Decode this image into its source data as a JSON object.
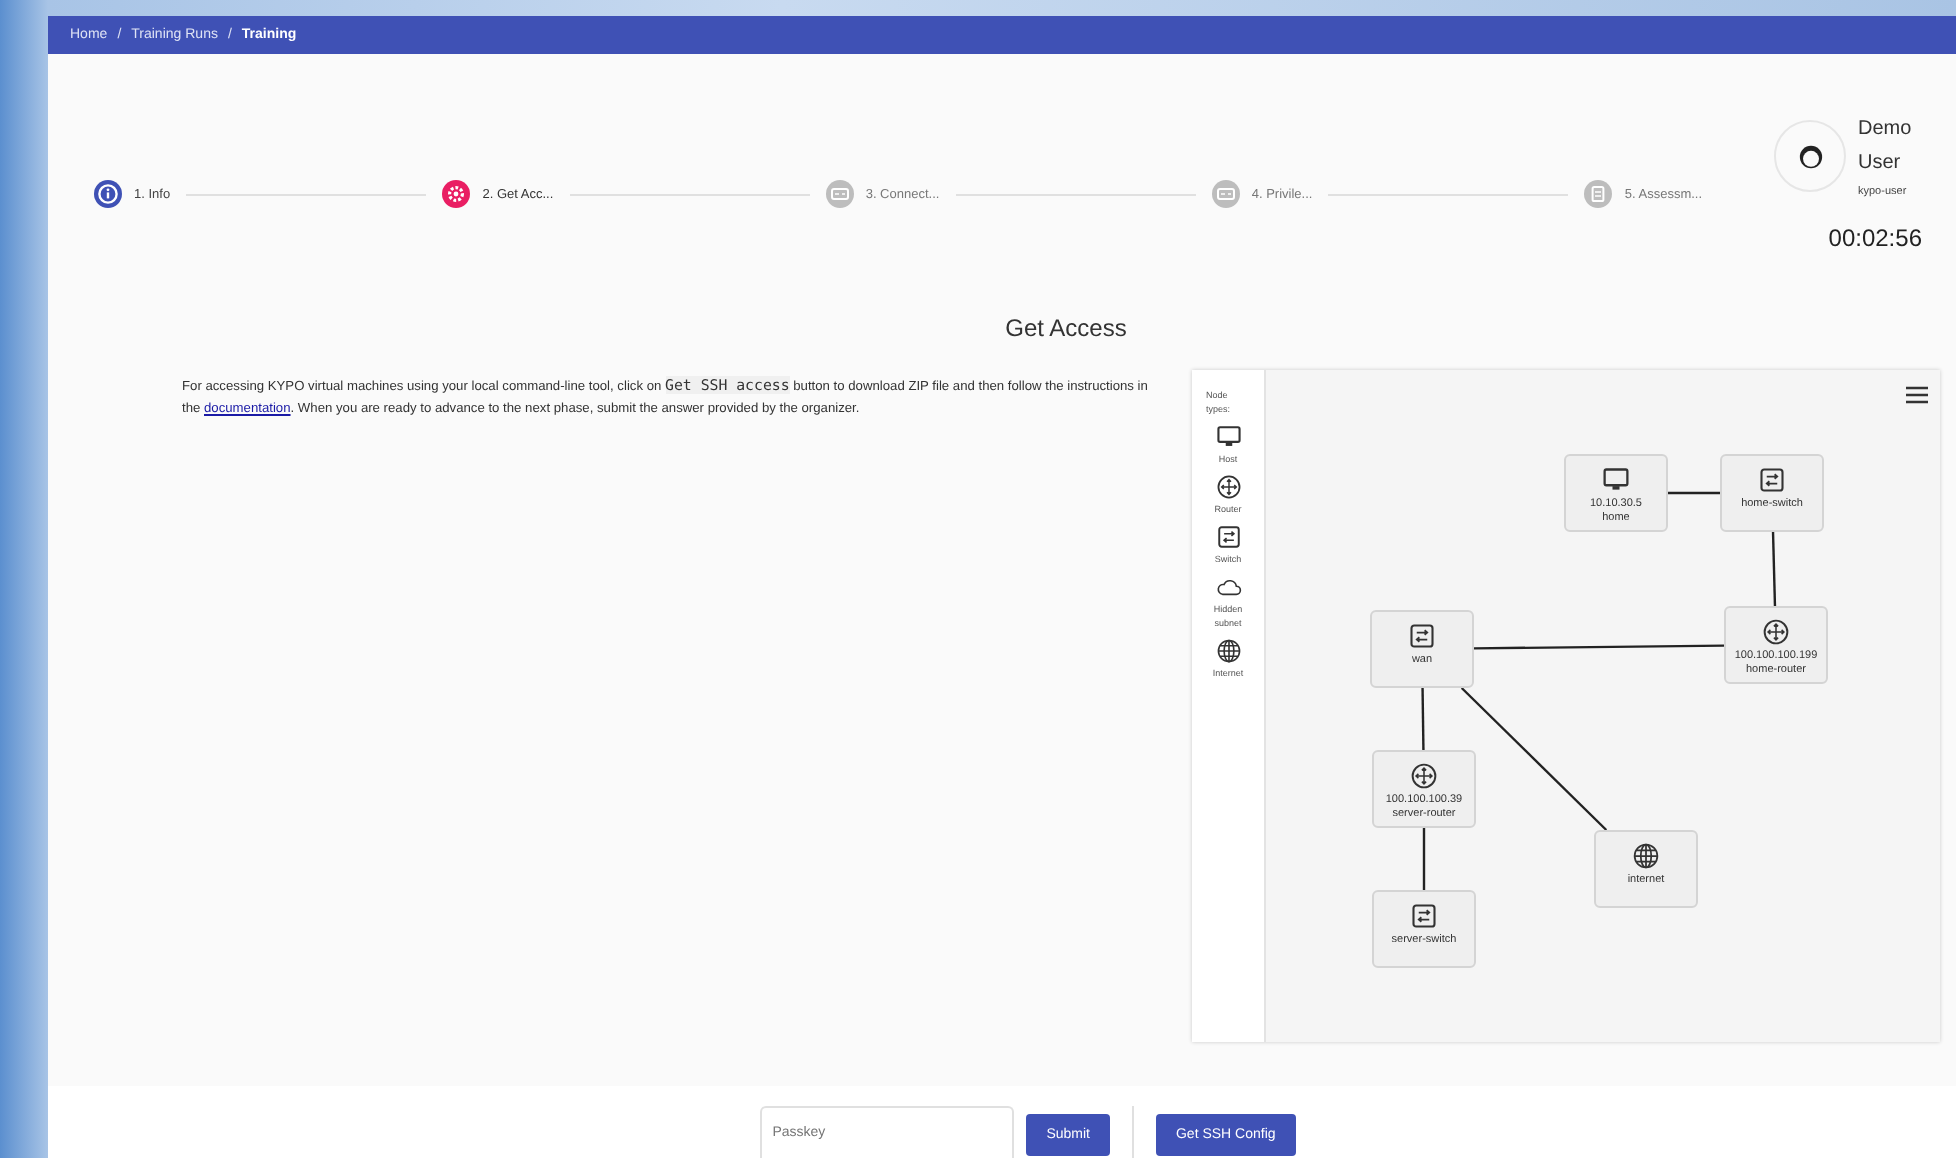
{
  "breadcrumb": [
    {
      "label": "Home",
      "current": false
    },
    {
      "label": "Training Runs",
      "current": false
    },
    {
      "label": "Training",
      "current": true
    }
  ],
  "breadcrumb_separator": "/",
  "steps": [
    {
      "label": "1. Info",
      "kind": "info",
      "selected": false,
      "disabled": false
    },
    {
      "label": "2. Get Acc...",
      "kind": "access",
      "selected": true,
      "disabled": false
    },
    {
      "label": "3. Connect...",
      "kind": "terminal",
      "selected": false,
      "disabled": true
    },
    {
      "label": "4. Privile...",
      "kind": "terminal",
      "selected": false,
      "disabled": true
    },
    {
      "label": "5. Assessm...",
      "kind": "assessment",
      "selected": false,
      "disabled": true
    }
  ],
  "user": {
    "name": "Demo User",
    "login": "kypo-user"
  },
  "timer": "00:02:56",
  "level_title": "Get Access",
  "instructions": {
    "before": "For accessing KYPO virtual machines using your local command-line tool, click on ",
    "code": "Get SSH access",
    "middle": " button to download ZIP file and then follow the instructions in the ",
    "link": "documentation",
    "after": ". When you are ready to advance to the next phase, submit the answer provided by the organizer."
  },
  "topology": {
    "legend_title": "Node types:",
    "legend": [
      {
        "kind": "host",
        "label": "Host"
      },
      {
        "kind": "router",
        "label": "Router"
      },
      {
        "kind": "switch",
        "label": "Switch"
      },
      {
        "kind": "cloud",
        "label": "Hidden subnet"
      },
      {
        "kind": "internet",
        "label": "Internet"
      }
    ],
    "nodes": [
      {
        "kind": "host",
        "address": "10.10.30.5",
        "name": "home"
      },
      {
        "kind": "switch",
        "name": "home-switch"
      },
      {
        "kind": "switch",
        "name": "wan"
      },
      {
        "kind": "router",
        "address": "100.100.100.199",
        "name": "home-router"
      },
      {
        "kind": "router",
        "address": "100.100.100.39",
        "name": "server-router"
      },
      {
        "kind": "internet",
        "name": "internet"
      },
      {
        "kind": "switch",
        "name": "server-switch"
      }
    ]
  },
  "answer": {
    "placeholder": "Passkey"
  },
  "submit_button": "Submit",
  "ssh_button": "Get SSH Config"
}
